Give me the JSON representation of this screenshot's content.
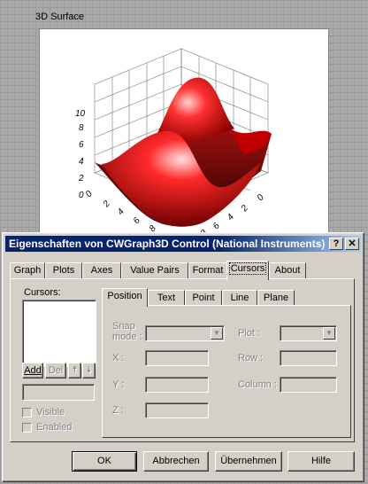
{
  "graph": {
    "label": "3D Surface",
    "z_ticks": [
      "0",
      "2",
      "4",
      "6",
      "8",
      "10"
    ],
    "x_ticks": [
      "0",
      "2",
      "4",
      "6",
      "8"
    ],
    "y_ticks": [
      "0",
      "2",
      "4",
      "6",
      "8"
    ]
  },
  "dialog": {
    "title": "Eigenschaften von CWGraph3D Control  (National Instruments)",
    "help_glyph": "?",
    "close_glyph": "✕",
    "tabs": [
      "Graph",
      "Plots",
      "Axes",
      "Value Pairs",
      "Format",
      "Cursors",
      "About"
    ],
    "active_tab": "Cursors",
    "cursors_label": "Cursors:",
    "add_label": "Add",
    "del_label": "Del",
    "up_glyph": "🠅",
    "down_glyph": "🠇",
    "visible_label": "Visible",
    "enabled_label": "Enabled",
    "inner_tabs": [
      "Position",
      "Text",
      "Point",
      "Line",
      "Plane"
    ],
    "active_inner_tab": "Position",
    "snap_label_1": "Snap",
    "snap_label_2": "mode :",
    "x_label": "X :",
    "y_label": "Y :",
    "z_label": "Z :",
    "plot_label": "Plot :",
    "row_label": "Row :",
    "column_label": "Column :",
    "buttons": {
      "ok": "OK",
      "cancel": "Abbrechen",
      "apply": "Übernehmen",
      "help": "Hilfe"
    }
  }
}
